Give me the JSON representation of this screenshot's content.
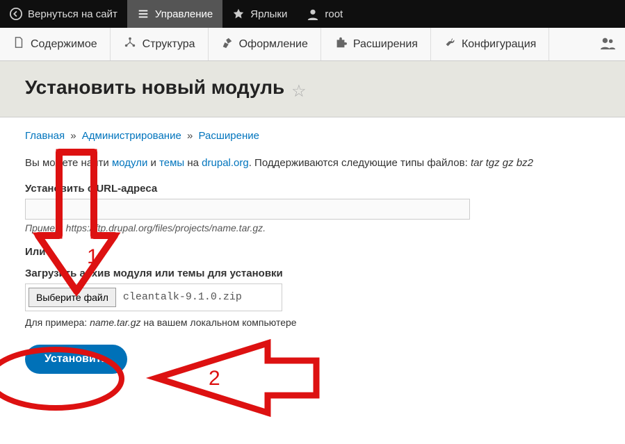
{
  "topbar": {
    "back": "Вернуться на сайт",
    "manage": "Управление",
    "shortcuts": "Ярлыки",
    "user": "root"
  },
  "tabs": {
    "content": "Содержимое",
    "structure": "Структура",
    "appearance": "Оформление",
    "extend": "Расширения",
    "config": "Конфигурация"
  },
  "page": {
    "title": "Установить новый модуль"
  },
  "breadcrumb": {
    "home": "Главная",
    "admin": "Администрирование",
    "extend": "Расширение"
  },
  "help": {
    "prefix": "Вы можете найти ",
    "modules": "модули",
    "and": " и ",
    "themes": "темы",
    "on": " на ",
    "drupal": "drupal.org",
    "suffix": ". Поддерживаются следующие типы файлов: ",
    "types": "tar tgz gz bz2"
  },
  "url_field": {
    "label": "Установить с URL-адреса",
    "value": "",
    "hint_prefix": "Пример: ",
    "hint_url": "https://ftp.drupal.org/files/projects/name.tar.gz",
    "hint_suffix": "."
  },
  "or_label": "Или",
  "upload_field": {
    "label": "Загрузить архив модуля или темы для установки",
    "button": "Выберите файл",
    "filename": "cleantalk-9.1.0.zip",
    "eg_prefix": "Для примера: ",
    "eg_file": "name.tar.gz",
    "eg_suffix": " на вашем локальном компьютере"
  },
  "install_button": "Установить",
  "annotations": {
    "one": "1",
    "two": "2"
  }
}
